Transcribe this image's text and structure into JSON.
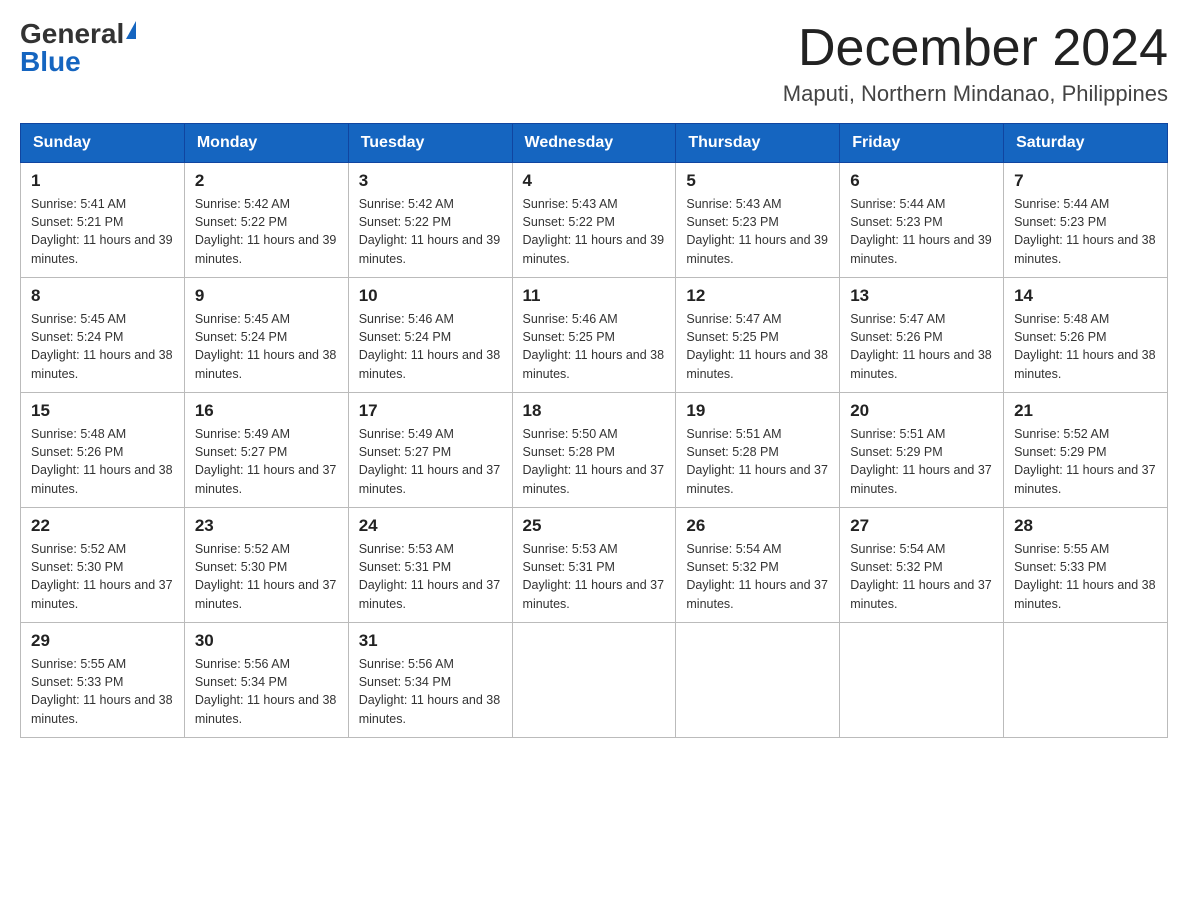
{
  "header": {
    "logo_general": "General",
    "logo_blue": "Blue",
    "month_title": "December 2024",
    "location": "Maputi, Northern Mindanao, Philippines"
  },
  "weekdays": [
    "Sunday",
    "Monday",
    "Tuesday",
    "Wednesday",
    "Thursday",
    "Friday",
    "Saturday"
  ],
  "weeks": [
    [
      {
        "day": "1",
        "sunrise": "5:41 AM",
        "sunset": "5:21 PM",
        "daylight": "11 hours and 39 minutes."
      },
      {
        "day": "2",
        "sunrise": "5:42 AM",
        "sunset": "5:22 PM",
        "daylight": "11 hours and 39 minutes."
      },
      {
        "day": "3",
        "sunrise": "5:42 AM",
        "sunset": "5:22 PM",
        "daylight": "11 hours and 39 minutes."
      },
      {
        "day": "4",
        "sunrise": "5:43 AM",
        "sunset": "5:22 PM",
        "daylight": "11 hours and 39 minutes."
      },
      {
        "day": "5",
        "sunrise": "5:43 AM",
        "sunset": "5:23 PM",
        "daylight": "11 hours and 39 minutes."
      },
      {
        "day": "6",
        "sunrise": "5:44 AM",
        "sunset": "5:23 PM",
        "daylight": "11 hours and 39 minutes."
      },
      {
        "day": "7",
        "sunrise": "5:44 AM",
        "sunset": "5:23 PM",
        "daylight": "11 hours and 38 minutes."
      }
    ],
    [
      {
        "day": "8",
        "sunrise": "5:45 AM",
        "sunset": "5:24 PM",
        "daylight": "11 hours and 38 minutes."
      },
      {
        "day": "9",
        "sunrise": "5:45 AM",
        "sunset": "5:24 PM",
        "daylight": "11 hours and 38 minutes."
      },
      {
        "day": "10",
        "sunrise": "5:46 AM",
        "sunset": "5:24 PM",
        "daylight": "11 hours and 38 minutes."
      },
      {
        "day": "11",
        "sunrise": "5:46 AM",
        "sunset": "5:25 PM",
        "daylight": "11 hours and 38 minutes."
      },
      {
        "day": "12",
        "sunrise": "5:47 AM",
        "sunset": "5:25 PM",
        "daylight": "11 hours and 38 minutes."
      },
      {
        "day": "13",
        "sunrise": "5:47 AM",
        "sunset": "5:26 PM",
        "daylight": "11 hours and 38 minutes."
      },
      {
        "day": "14",
        "sunrise": "5:48 AM",
        "sunset": "5:26 PM",
        "daylight": "11 hours and 38 minutes."
      }
    ],
    [
      {
        "day": "15",
        "sunrise": "5:48 AM",
        "sunset": "5:26 PM",
        "daylight": "11 hours and 38 minutes."
      },
      {
        "day": "16",
        "sunrise": "5:49 AM",
        "sunset": "5:27 PM",
        "daylight": "11 hours and 37 minutes."
      },
      {
        "day": "17",
        "sunrise": "5:49 AM",
        "sunset": "5:27 PM",
        "daylight": "11 hours and 37 minutes."
      },
      {
        "day": "18",
        "sunrise": "5:50 AM",
        "sunset": "5:28 PM",
        "daylight": "11 hours and 37 minutes."
      },
      {
        "day": "19",
        "sunrise": "5:51 AM",
        "sunset": "5:28 PM",
        "daylight": "11 hours and 37 minutes."
      },
      {
        "day": "20",
        "sunrise": "5:51 AM",
        "sunset": "5:29 PM",
        "daylight": "11 hours and 37 minutes."
      },
      {
        "day": "21",
        "sunrise": "5:52 AM",
        "sunset": "5:29 PM",
        "daylight": "11 hours and 37 minutes."
      }
    ],
    [
      {
        "day": "22",
        "sunrise": "5:52 AM",
        "sunset": "5:30 PM",
        "daylight": "11 hours and 37 minutes."
      },
      {
        "day": "23",
        "sunrise": "5:52 AM",
        "sunset": "5:30 PM",
        "daylight": "11 hours and 37 minutes."
      },
      {
        "day": "24",
        "sunrise": "5:53 AM",
        "sunset": "5:31 PM",
        "daylight": "11 hours and 37 minutes."
      },
      {
        "day": "25",
        "sunrise": "5:53 AM",
        "sunset": "5:31 PM",
        "daylight": "11 hours and 37 minutes."
      },
      {
        "day": "26",
        "sunrise": "5:54 AM",
        "sunset": "5:32 PM",
        "daylight": "11 hours and 37 minutes."
      },
      {
        "day": "27",
        "sunrise": "5:54 AM",
        "sunset": "5:32 PM",
        "daylight": "11 hours and 37 minutes."
      },
      {
        "day": "28",
        "sunrise": "5:55 AM",
        "sunset": "5:33 PM",
        "daylight": "11 hours and 38 minutes."
      }
    ],
    [
      {
        "day": "29",
        "sunrise": "5:55 AM",
        "sunset": "5:33 PM",
        "daylight": "11 hours and 38 minutes."
      },
      {
        "day": "30",
        "sunrise": "5:56 AM",
        "sunset": "5:34 PM",
        "daylight": "11 hours and 38 minutes."
      },
      {
        "day": "31",
        "sunrise": "5:56 AM",
        "sunset": "5:34 PM",
        "daylight": "11 hours and 38 minutes."
      },
      null,
      null,
      null,
      null
    ]
  ]
}
